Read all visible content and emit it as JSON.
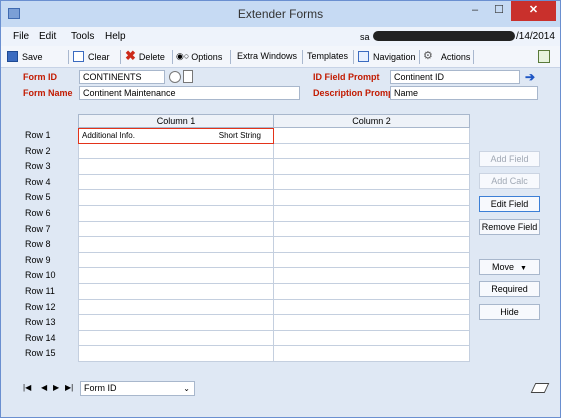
{
  "window": {
    "title": "Extender Forms"
  },
  "controls": {
    "minimize": "–",
    "maximize": "☐",
    "close": "✕"
  },
  "menu": {
    "file": "File",
    "edit": "Edit",
    "tools": "Tools",
    "help": "Help"
  },
  "session": {
    "user": "sa",
    "date_suffix": "/14/2014"
  },
  "toolbar": {
    "save": "Save",
    "clear": "Clear",
    "delete": "Delete",
    "options": "Options",
    "options_prefix": "◉○",
    "extra_windows": "Extra Windows",
    "templates": "Templates",
    "navigation": "Navigation",
    "actions": "Actions"
  },
  "form": {
    "form_id_label": "Form ID",
    "form_id_value": "CONTINENTS",
    "form_name_label": "Form Name",
    "form_name_value": "Continent Maintenance",
    "id_field_prompt_label": "ID Field Prompt",
    "id_field_prompt_value": "Continent ID",
    "description_prompt_label": "Description Prompt",
    "description_prompt_value": "Name"
  },
  "grid": {
    "columns": [
      "Column 1",
      "Column 2"
    ],
    "rows": [
      {
        "label": "Row 1",
        "c1_text": "Additional Info.",
        "c1_type": "Short String",
        "c2": ""
      },
      {
        "label": "Row 2",
        "c1_text": "",
        "c1_type": "",
        "c2": ""
      },
      {
        "label": "Row 3",
        "c1_text": "",
        "c1_type": "",
        "c2": ""
      },
      {
        "label": "Row 4",
        "c1_text": "",
        "c1_type": "",
        "c2": ""
      },
      {
        "label": "Row 5",
        "c1_text": "",
        "c1_type": "",
        "c2": ""
      },
      {
        "label": "Row 6",
        "c1_text": "",
        "c1_type": "",
        "c2": ""
      },
      {
        "label": "Row 7",
        "c1_text": "",
        "c1_type": "",
        "c2": ""
      },
      {
        "label": "Row 8",
        "c1_text": "",
        "c1_type": "",
        "c2": ""
      },
      {
        "label": "Row 9",
        "c1_text": "",
        "c1_type": "",
        "c2": ""
      },
      {
        "label": "Row 10",
        "c1_text": "",
        "c1_type": "",
        "c2": ""
      },
      {
        "label": "Row 11",
        "c1_text": "",
        "c1_type": "",
        "c2": ""
      },
      {
        "label": "Row 12",
        "c1_text": "",
        "c1_type": "",
        "c2": ""
      },
      {
        "label": "Row 13",
        "c1_text": "",
        "c1_type": "",
        "c2": ""
      },
      {
        "label": "Row 14",
        "c1_text": "",
        "c1_type": "",
        "c2": ""
      },
      {
        "label": "Row 15",
        "c1_text": "",
        "c1_type": "",
        "c2": ""
      }
    ]
  },
  "side_buttons": {
    "add_field": "Add Field",
    "add_calc": "Add Calc",
    "edit_field": "Edit Field",
    "remove_field": "Remove Field",
    "move": "Move",
    "required": "Required",
    "hide": "Hide"
  },
  "footer": {
    "nav_first": "|◀",
    "nav_prev": "◀",
    "nav_next": "▶",
    "nav_last": "▶|",
    "sort_value": "Form ID"
  },
  "colors": {
    "label_red": "#c21a00",
    "accent_blue": "#3b6bc0",
    "close_red": "#c9302c"
  },
  "icons": [
    "app-icon",
    "save-icon",
    "clear-icon",
    "delete-icon",
    "options-radio-icon",
    "navigation-icon",
    "actions-gear-icon",
    "print-icon",
    "lookup-icon",
    "note-icon",
    "arrow-right-icon",
    "eraser-icon"
  ]
}
